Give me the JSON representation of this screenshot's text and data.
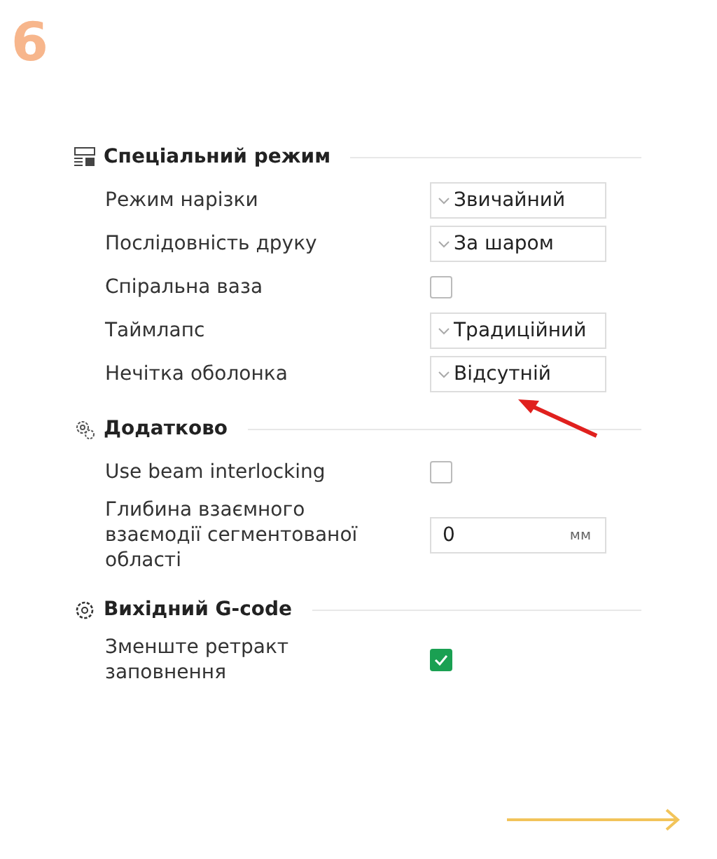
{
  "step_number": "6",
  "sections": [
    {
      "title": "Спеціальний режим",
      "kind": "layout",
      "rows": [
        {
          "kind": "select",
          "label": "Режим нарізки",
          "value": "Звичайний"
        },
        {
          "kind": "select",
          "label": "Послідовність друку",
          "value": "За шаром"
        },
        {
          "kind": "checkbox",
          "label": "Спіральна ваза",
          "checked": false
        },
        {
          "kind": "select",
          "label": "Таймлапс",
          "value": "Традиційний"
        },
        {
          "kind": "select",
          "label": "Нечітка оболонка",
          "value": "Відсутній",
          "annotated": true
        }
      ]
    },
    {
      "title": "Додатково",
      "kind": "gears",
      "rows": [
        {
          "kind": "checkbox",
          "label": "Use beam interlocking",
          "checked": false
        },
        {
          "kind": "number",
          "label": "Глибина взаємного взаємодії сегментованої області",
          "value": "0",
          "unit": "мм"
        }
      ]
    },
    {
      "title": "Вихідний G-code",
      "kind": "gear",
      "rows": [
        {
          "kind": "checkbox",
          "label": "Зменште ретракт заповнення",
          "checked": true
        }
      ]
    }
  ]
}
